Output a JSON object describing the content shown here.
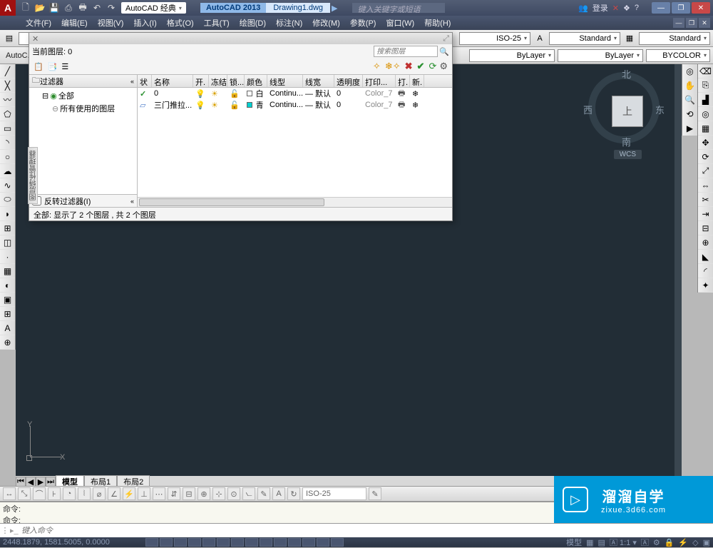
{
  "titlebar": {
    "workspace": "AutoCAD 经典",
    "app": "AutoCAD 2013",
    "doc": "Drawing1.dwg",
    "search_placeholder": "键入关键字或短语",
    "login": "登录"
  },
  "menu": {
    "items": [
      "文件(F)",
      "编辑(E)",
      "视图(V)",
      "插入(I)",
      "格式(O)",
      "工具(T)",
      "绘图(D)",
      "标注(N)",
      "修改(M)",
      "参数(P)",
      "窗口(W)",
      "帮助(H)"
    ]
  },
  "props": {
    "dim_style": "ISO-25",
    "text_style": "Standard",
    "table_style": "Standard",
    "layer_color": "ByLayer",
    "layer_ltype": "ByLayer",
    "layer_bycolor": "BYCOLOR"
  },
  "autoc_label": "AutoC...",
  "viewcube": {
    "top": "上",
    "n": "北",
    "s": "南",
    "e": "东",
    "w": "西",
    "wcs": "WCS"
  },
  "ucs": {
    "x": "X",
    "y": "Y"
  },
  "layout_tabs": {
    "active": "模型",
    "others": [
      "布局1",
      "布局2"
    ]
  },
  "snapbar": {
    "dd": "ISO-25"
  },
  "cmd": {
    "line1": "命令:",
    "line2": "命令:",
    "prompt_placeholder": "键入命令"
  },
  "status": {
    "coords": "2448.1879, 1581.5005, 0.0000",
    "model": "模型",
    "scale": "1:1"
  },
  "watermark": {
    "big": "溜溜自学",
    "small": "zixue.3d66.com"
  },
  "layerdlg": {
    "current_label": "当前图层: 0",
    "search_placeholder": "搜索图层",
    "filter_header": "过滤器",
    "tree_all": "全部",
    "tree_used": "所有使用的图层",
    "invert": "反转过滤器(I)",
    "invert_checked": false,
    "columns": [
      "状",
      "名称",
      "开.",
      "冻结",
      "锁...",
      "颜色",
      "线型",
      "线宽",
      "透明度",
      "打印...",
      "打.",
      "新."
    ],
    "rows": [
      {
        "status": "✓",
        "name": "0",
        "on": true,
        "freeze": false,
        "lock": false,
        "color": "白",
        "swatch": "#ffffff",
        "ltype": "Continu...",
        "lweight": "— 默认",
        "trans": "0",
        "pstyle": "Color_7",
        "plot": true
      },
      {
        "status": "",
        "name": "三门推拉...",
        "on": true,
        "freeze": false,
        "lock": false,
        "color": "青",
        "swatch": "#00d0d0",
        "ltype": "Continu...",
        "lweight": "— 默认",
        "trans": "0",
        "pstyle": "Color_7",
        "plot": true
      }
    ],
    "footer": "全部: 显示了 2 个图层 , 共 2 个图层",
    "side_label": "图层特性管理器"
  }
}
